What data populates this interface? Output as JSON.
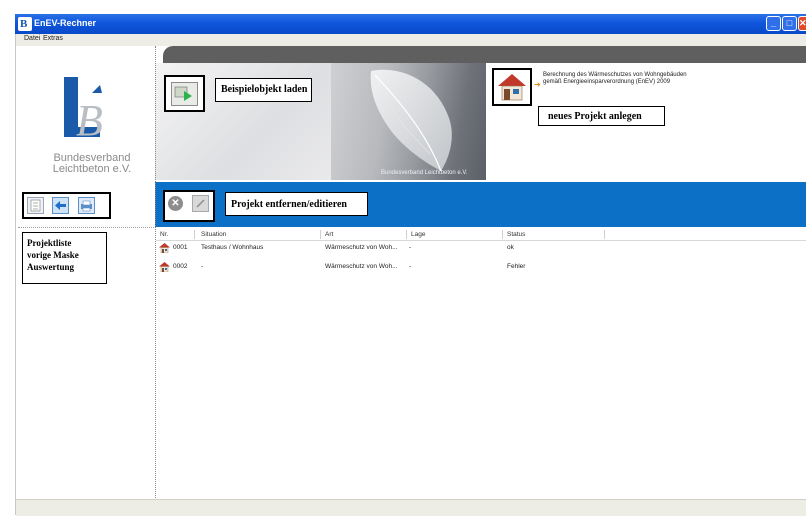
{
  "window": {
    "title": "EnEV-Rechner",
    "app_icon_letter": "B",
    "buttons": {
      "minimize": "_",
      "maximize": "□",
      "close": "✕"
    }
  },
  "menu": {
    "items": [
      "Datei",
      "Extras"
    ]
  },
  "logo": {
    "line1": "Bundesverband",
    "line2": "Leichtbeton e.V."
  },
  "banner": {
    "sample_label": "Beispielobjekt laden",
    "photo_credit": "Bundesverband Leichtbeton e.V.",
    "description": "Berechnung des Wärmeschutzes von Wohngebäuden gemäß Energieeinsparverordnung (EnEV) 2009",
    "new_project_label": "neues Projekt anlegen"
  },
  "toolbar": {
    "project_label": "Projekt entfernen/editieren"
  },
  "legend": [
    "Projektliste",
    "vorige Maske",
    "Auswertung"
  ],
  "table": {
    "columns": [
      "Nr.",
      "Situation",
      "Art",
      "Lage",
      "Status"
    ],
    "rows": [
      {
        "nr": "0001",
        "situation": "Testhaus / Wohnhaus",
        "art": "Wärmeschutz von Woh...",
        "lage": "-",
        "status": "ok"
      },
      {
        "nr": "0002",
        "situation": "-",
        "art": "Wärmeschutz von Woh...",
        "lage": "-",
        "status": "Fehler"
      }
    ]
  },
  "colors": {
    "titlebar": "#0e56dc",
    "toolbar_blue": "#0c71c6",
    "logo_blue": "#1a5aa8",
    "house_roof": "#c0392b"
  },
  "icons": [
    "app-icon",
    "sample-object-icon",
    "new-project-house-icon",
    "remove-icon",
    "edit-icon",
    "project-list-icon",
    "back-arrow-icon",
    "print-icon",
    "house-icon"
  ]
}
